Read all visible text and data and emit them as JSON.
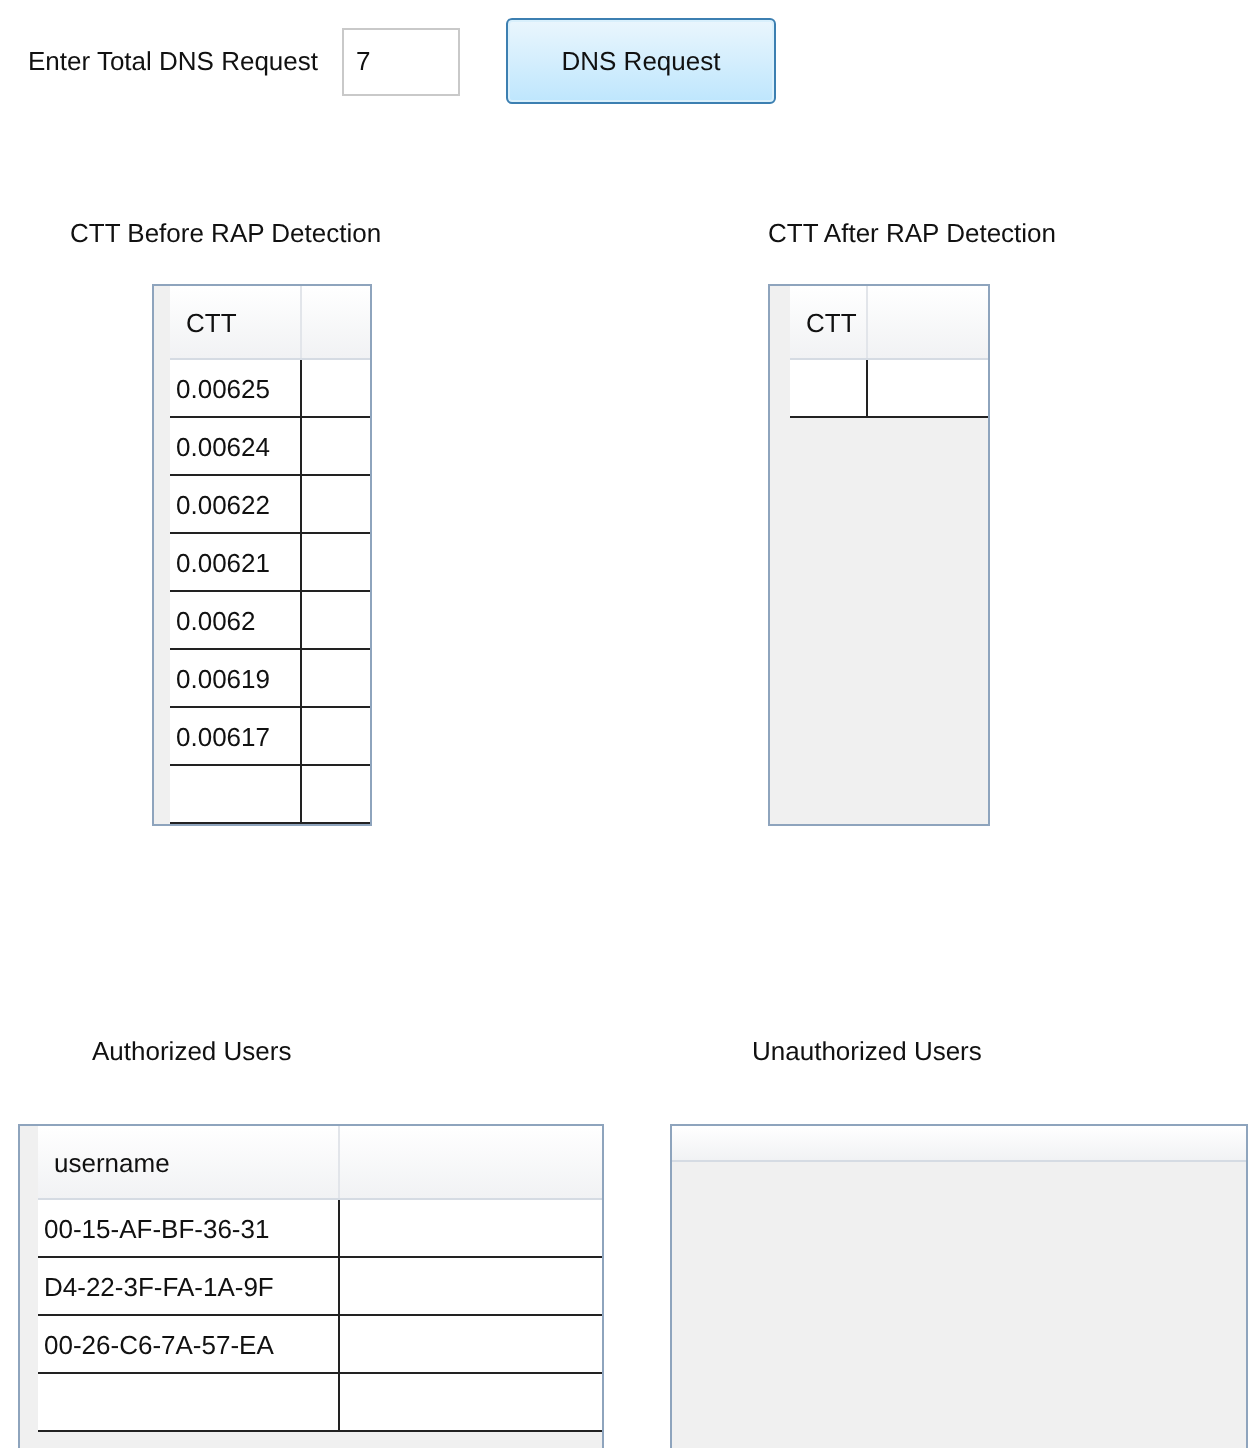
{
  "controls": {
    "label": "Enter Total DNS Request",
    "input": {
      "value": "7"
    },
    "button": "DNS Request"
  },
  "ctt_before": {
    "title": "CTT Before RAP Detection",
    "columns": [
      "CTT"
    ],
    "rows": [
      [
        "0.00625"
      ],
      [
        "0.00624"
      ],
      [
        "0.00622"
      ],
      [
        "0.00621"
      ],
      [
        "0.0062"
      ],
      [
        "0.00619"
      ],
      [
        "0.00617"
      ]
    ],
    "new_row": true
  },
  "ctt_after": {
    "title": "CTT After RAP Detection",
    "columns": [
      "CTT"
    ],
    "new_row": true
  },
  "authorized_users": {
    "title": "Authorized Users",
    "columns": [
      "username"
    ],
    "rows": [
      [
        "00-15-AF-BF-36-31"
      ],
      [
        "D4-22-3F-FA-1A-9F"
      ],
      [
        "00-26-C6-7A-57-EA"
      ]
    ],
    "new_row": true
  },
  "unauthorized_users": {
    "title": "Unauthorized Users"
  }
}
